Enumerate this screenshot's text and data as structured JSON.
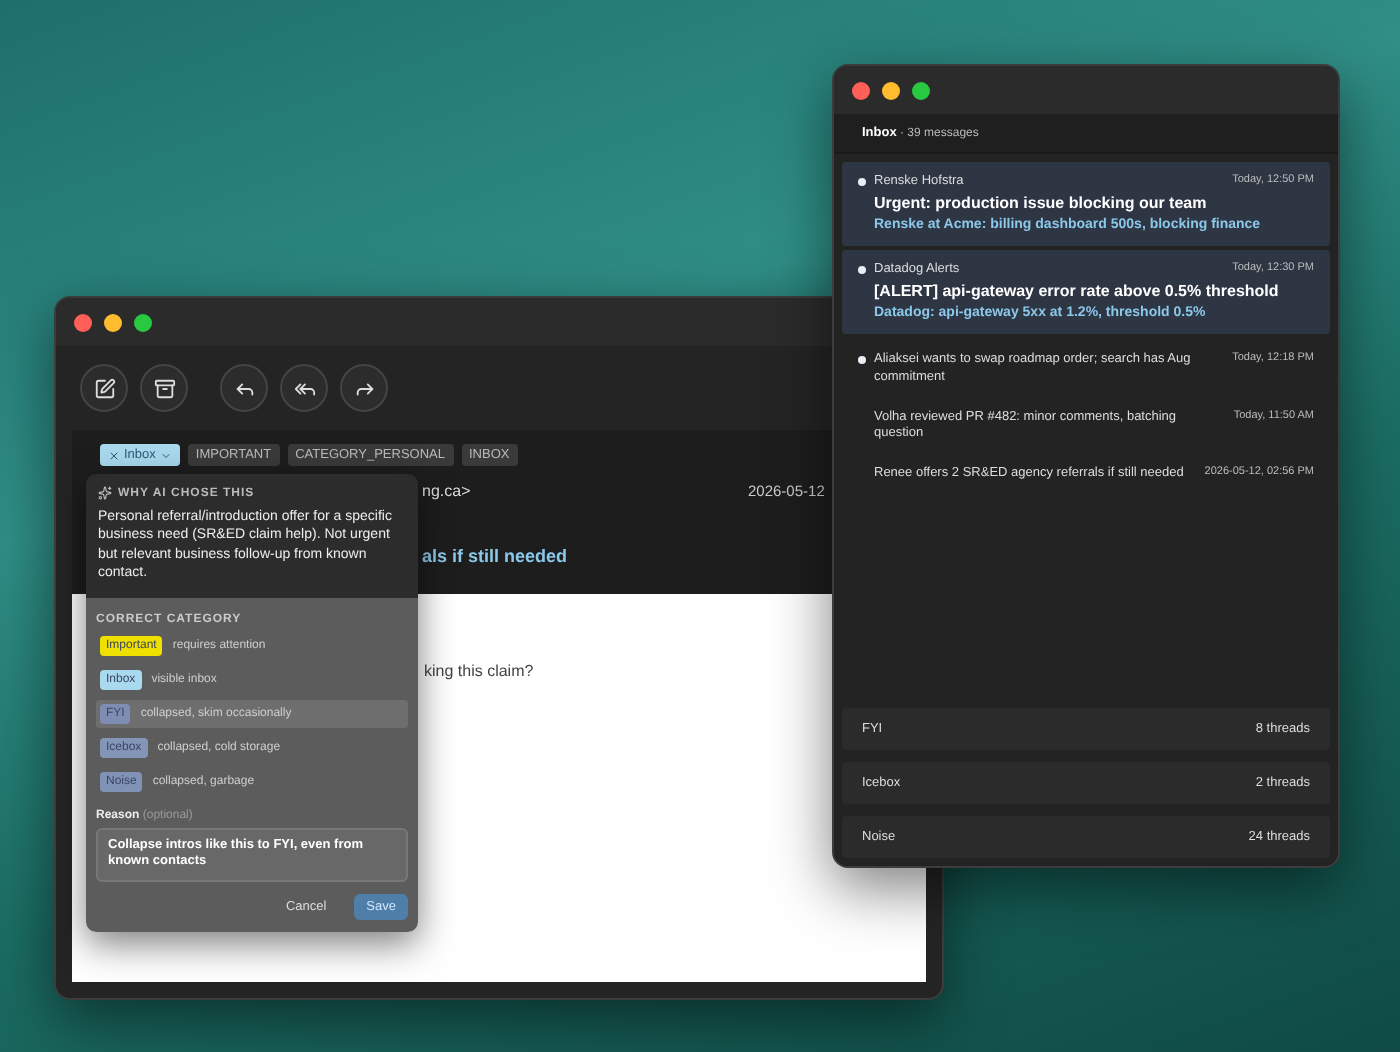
{
  "left_window": {
    "tags": [
      {
        "label": "Inbox",
        "kind": "editable"
      },
      {
        "label": "IMPORTANT",
        "kind": "plain"
      },
      {
        "label": "CATEGORY_PERSONAL",
        "kind": "plain"
      },
      {
        "label": "INBOX",
        "kind": "plain"
      }
    ],
    "sender_fragment": "ng.ca>",
    "date": "2026-05-12",
    "subject_fragment": "als if still needed",
    "body_fragment": "king this claim?"
  },
  "popover": {
    "heading": "WHY AI CHOSE THIS",
    "explanation": "Personal referral/introduction offer for a specific business need (SR&ED claim help). Not urgent but relevant business follow-up from known contact.",
    "category_heading": "CORRECT CATEGORY",
    "categories": [
      {
        "label": "Important",
        "description": "requires attention",
        "color": "#efe000",
        "selected": false
      },
      {
        "label": "Inbox",
        "description": "visible inbox",
        "color": "#a9d9ee",
        "selected": false
      },
      {
        "label": "FYI",
        "description": "collapsed, skim occasionally",
        "color": "#7e8db3",
        "selected": true
      },
      {
        "label": "Icebox",
        "description": "collapsed, cold storage",
        "color": "#8396b8",
        "selected": false
      },
      {
        "label": "Noise",
        "description": "collapsed, garbage",
        "color": "#8093b6",
        "selected": false
      }
    ],
    "reason_label": "**Reason** (optional)",
    "reason": "Collapse intros like this to FYI, even from known contacts",
    "buttons": [
      {
        "label": "Cancel",
        "kind": "secondary"
      },
      {
        "label": "Save",
        "kind": "primary"
      }
    ]
  },
  "right_window": {
    "title": "**Inbox** · 39 messages",
    "messages": [
      {
        "kind": "card",
        "unread": true,
        "sender": "Renske Hofstra",
        "time": "Today, 12:50 PM",
        "subject": "Urgent: production issue blocking our team",
        "summary": "Renske at Acme: billing dashboard 500s, blocking finance"
      },
      {
        "kind": "card",
        "unread": true,
        "sender": "Datadog Alerts",
        "time": "Today, 12:30 PM",
        "subject": "[ALERT] api-gateway error rate above 0.5% threshold",
        "summary": "Datadog: api-gateway 5xx at 1.2%, threshold 0.5%"
      },
      {
        "kind": "compact",
        "unread": true,
        "text": "Aliaksei wants to swap roadmap order; search has Aug commitment",
        "time": "Today, 12:18 PM"
      },
      {
        "kind": "compact",
        "unread": false,
        "text": "Volha reviewed PR #482: minor comments, batching question",
        "time": "Today, 11:50 AM"
      },
      {
        "kind": "compact",
        "unread": false,
        "text": "Renee offers 2 SR&ED agency referrals if still needed",
        "time": "2026-05-12, 02:56 PM"
      }
    ],
    "groups": [
      {
        "name": "FYI",
        "count": "8 threads"
      },
      {
        "name": "Icebox",
        "count": "2 threads"
      },
      {
        "name": "Noise",
        "count": "24 threads"
      }
    ]
  }
}
